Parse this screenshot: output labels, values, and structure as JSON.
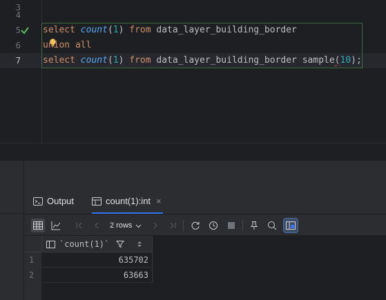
{
  "editor": {
    "line_numbers": [
      "3",
      "4",
      "5",
      "6",
      "7"
    ],
    "code": {
      "line5": [
        "select ",
        "count",
        "(",
        "1",
        ") ",
        "from",
        " data_layer_building_border"
      ],
      "line6": [
        "union all"
      ],
      "line7": [
        "select ",
        "count",
        "(",
        "1",
        ") ",
        "from",
        " data_layer_building_border sample",
        "(",
        "10",
        ");"
      ]
    },
    "status_icon": "check-icon",
    "hint_icon": "lightbulb-icon"
  },
  "tool_window": {
    "tabs": [
      {
        "label": "Output",
        "icon": "terminal-icon"
      },
      {
        "label": "count(1):int",
        "icon": "table-icon",
        "closable": true,
        "close_glyph": "×"
      }
    ],
    "toolbar": {
      "rows_label": "2 rows",
      "icons": [
        "table-view-icon",
        "chart-icon",
        "first-page-icon",
        "previous-page-icon",
        "next-page-icon",
        "last-page-icon",
        "refresh-icon",
        "history-icon",
        "stop-icon",
        "pin-icon",
        "search-icon",
        "layout-icon"
      ]
    },
    "grid": {
      "column": "`count(1)`",
      "rows": [
        {
          "num": "1",
          "value": "635702"
        },
        {
          "num": "2",
          "value": "63663"
        }
      ]
    }
  },
  "colors": {
    "keyword": "#cf8e6d",
    "function": "#56a8f5",
    "number": "#2aacb8",
    "accent": "#3574f0",
    "success": "#5fb865"
  }
}
